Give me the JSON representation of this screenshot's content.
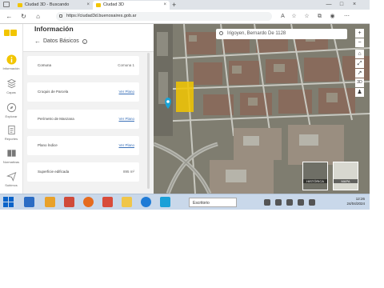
{
  "browser": {
    "tabs": [
      {
        "label": "Ciudad 3D - Buscando",
        "active": false
      },
      {
        "label": "Ciudad 3D",
        "active": true
      }
    ],
    "url": "https://ciudad3d.buenosaires.gob.ar",
    "zoom_icon": "A",
    "win_min": "—",
    "win_max": "□"
  },
  "sidebar": {
    "items": [
      {
        "label": "Información",
        "icon": "info-icon"
      },
      {
        "label": "Capas",
        "icon": "layers-icon"
      },
      {
        "label": "Explorar",
        "icon": "explore-icon"
      },
      {
        "label": "Reportes",
        "icon": "reports-icon"
      },
      {
        "label": "Normativas",
        "icon": "book-icon"
      },
      {
        "label": "Subimos",
        "icon": "send-icon"
      }
    ]
  },
  "panel": {
    "title": "Información",
    "section": "Datos Básicos",
    "info_glyph": "i",
    "rows": [
      {
        "key": "Comuna",
        "value": "Comuna 1",
        "link": false
      },
      {
        "key": "Croquis de Parcela",
        "value": "Ver Plano",
        "link": true
      },
      {
        "key": "Perímetro de Manzana",
        "value": "Ver Plano",
        "link": true
      },
      {
        "key": "Plano Índice",
        "value": "Ver Plano",
        "link": true
      },
      {
        "key": "Superficie edificada",
        "value": "895 m²",
        "link": false
      }
    ]
  },
  "map": {
    "search_value": "Irigoyen, Bernardo De 1128",
    "controls": [
      "+",
      "−",
      "⌂",
      "⤢",
      "↗",
      "3D",
      "♟"
    ],
    "thumbnails": [
      {
        "label": "HISTÓRICA"
      },
      {
        "label": "MAPA"
      }
    ],
    "colors": {
      "highlight": "#f2c500",
      "marker": "#1aa3d6"
    }
  },
  "taskbar": {
    "system_label": "Escritorio",
    "time": "12:26",
    "date": "24/04/2024"
  }
}
